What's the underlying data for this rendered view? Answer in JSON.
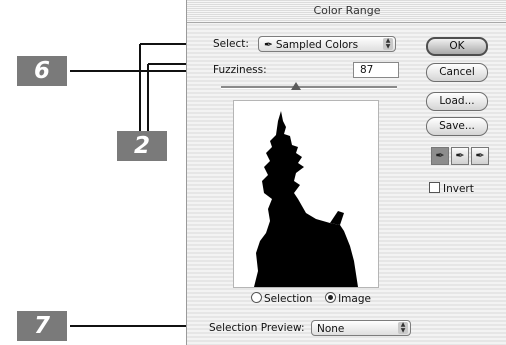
{
  "dialog": {
    "title": "Color Range",
    "select_label": "Select:",
    "select_value": "Sampled Colors",
    "fuzziness_label": "Fuzziness:",
    "fuzziness_value": "87",
    "fuzziness_slider_fraction": 0.55,
    "radio_selection_label": "Selection",
    "radio_image_label": "Image",
    "radio_selected": "Image",
    "selection_preview_label": "Selection Preview:",
    "selection_preview_value": "None",
    "buttons": {
      "ok": "OK",
      "cancel": "Cancel",
      "load": "Load...",
      "save": "Save..."
    },
    "eyedropper_tools": [
      "eyedropper-icon",
      "eyedropper-plus-icon",
      "eyedropper-minus-icon"
    ],
    "invert_label": "Invert",
    "invert_checked": false
  },
  "callouts": [
    "6",
    "2",
    "7"
  ],
  "colors": {
    "callout_bg": "#7a7a7a",
    "callout_text": "#ffffff",
    "leader_line": "#111111",
    "preview_mask": "#000000"
  }
}
